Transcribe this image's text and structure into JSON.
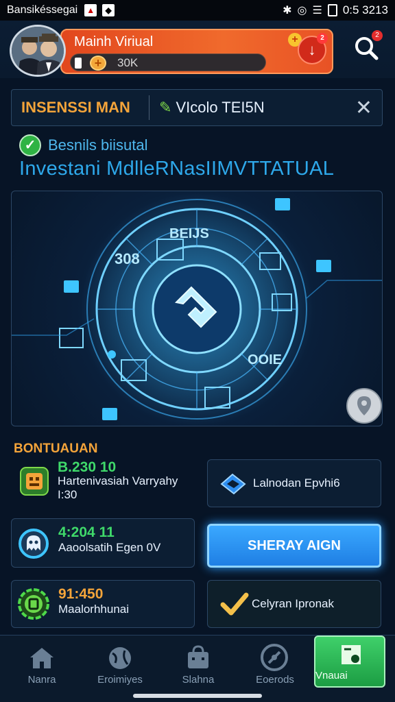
{
  "status_bar": {
    "carrier": "Bansikéssegai",
    "time": "0:5 3213"
  },
  "header": {
    "profile_name": "Mainh Viriual",
    "coin_value": "30K",
    "alert_badge": "2",
    "search_badge": "2"
  },
  "banner": {
    "left": "INSENSSI MAN",
    "right": "VIcolo TEI5N"
  },
  "subtitle": "Besnils biisutal",
  "title": "Investani MdlleRNasIIMVTTATUAL",
  "hero": {
    "label_top": "BEIJS",
    "label_left": "308",
    "label_right": "OOIE"
  },
  "section_label": "BONTUAUAN",
  "cards": [
    {
      "value": "B.230 10",
      "text": "Hartenivasiah Varryahy",
      "sub": "I:30",
      "value_color": "#3fd96a"
    },
    {
      "text": "Lalnodan Epvhi6"
    },
    {
      "value": "4:204 11",
      "text": "Aaoolsatih Egen 0V",
      "value_color": "#3fd96a"
    },
    {
      "value": "91:450",
      "text": "Maalorhhunai",
      "value_color": "#f4a43a"
    },
    {
      "text": "Celyran Ipronak"
    }
  ],
  "cta_label": "SHERAY AIGN",
  "nav": [
    {
      "label": "Nanra"
    },
    {
      "label": "Eroimiyes"
    },
    {
      "label": "Slahna"
    },
    {
      "label": "Eoerods"
    },
    {
      "label": "Vnauai"
    }
  ],
  "colors": {
    "accent_orange": "#f4a43a",
    "accent_blue": "#2ea8ea",
    "accent_green": "#3fd96a",
    "header_orange": "#f06a2c"
  }
}
